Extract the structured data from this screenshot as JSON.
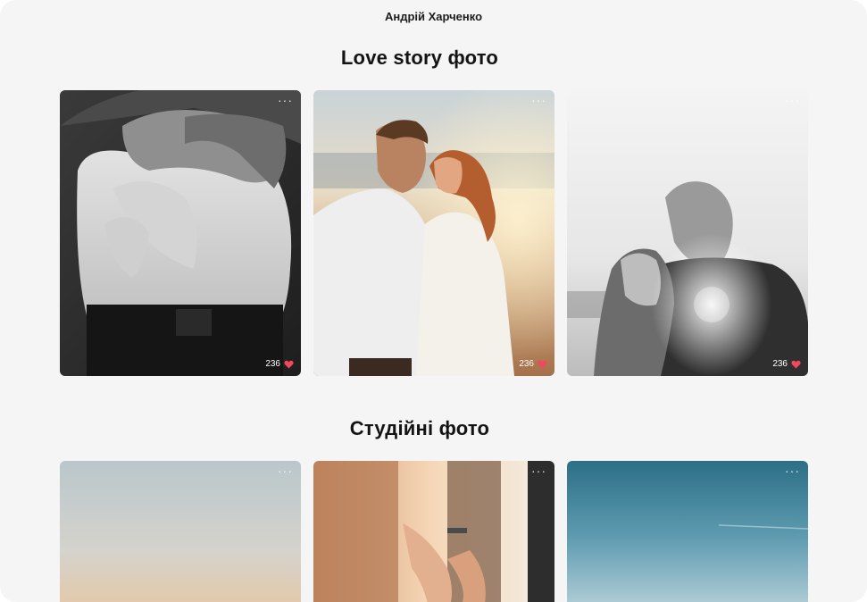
{
  "header": {
    "author_name": "Андрій Харченко"
  },
  "sections": [
    {
      "title": "Love story фото",
      "photos": [
        {
          "likes": "236",
          "more_label": "···"
        },
        {
          "likes": "236",
          "more_label": "···"
        },
        {
          "likes": "236",
          "more_label": "···"
        }
      ]
    },
    {
      "title": "Студійні фото",
      "photos": [
        {
          "more_label": "···"
        },
        {
          "more_label": "···"
        },
        {
          "more_label": "···"
        }
      ]
    }
  ],
  "colors": {
    "page_background": "#f5f5f5",
    "heart": "#f0485e"
  },
  "icons": {
    "likes": "heart-icon",
    "menu": "more-dots-icon"
  }
}
